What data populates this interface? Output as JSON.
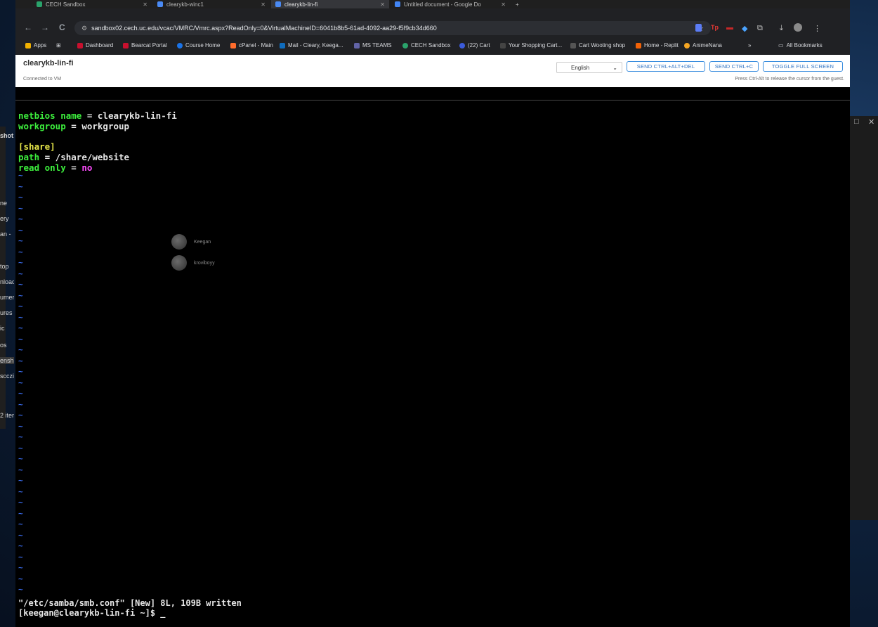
{
  "browser": {
    "tabs": [
      {
        "label": "CECH Sandbox",
        "active": false
      },
      {
        "label": "clearykb-winc1",
        "active": false
      },
      {
        "label": "clearykb-lin-fi",
        "active": true
      },
      {
        "label": "Untitled document - Google Do",
        "active": false
      }
    ],
    "new_tab": "+",
    "url": "sandbox02.cech.uc.edu/vcac/VMRC/Vmrc.aspx?ReadOnly=0&VirtualMachineID=6041b8b5-61ad-4092-aa29-f5f9cb34d660",
    "bookmarks": [
      {
        "label": "Apps",
        "color": "#f2b100"
      },
      {
        "label": "Dashboard",
        "color": "#c8102e"
      },
      {
        "label": "Bearcat Portal",
        "color": "#c8102e"
      },
      {
        "label": "Course Home",
        "color": "#1a73e8"
      },
      {
        "label": "cPanel - Main",
        "color": "#ff6c2c"
      },
      {
        "label": "Mail - Cleary, Keega...",
        "color": "#0f6cbd"
      },
      {
        "label": "MS TEAMS",
        "color": "#6264a7"
      },
      {
        "label": "CECH Sandbox",
        "color": "#2aa36b"
      },
      {
        "label": "(22) Cart",
        "color": "#3b5bdb"
      },
      {
        "label": "Your Shopping Cart...",
        "color": "#444"
      },
      {
        "label": "Cart Wooting shop",
        "color": "#555"
      },
      {
        "label": "Home - Replit",
        "color": "#f26207"
      },
      {
        "label": "AnimeNana",
        "color": "#f5a623"
      }
    ],
    "more_bookmarks": "»",
    "all_bookmarks": "All Bookmarks"
  },
  "vm": {
    "name": "clearykb-lin-fi",
    "status": "Connected to VM",
    "language": "English",
    "send_cad": "SEND CTRL+ALT+DEL",
    "send_ctrl_c": "SEND CTRL+C",
    "toggle_fullscreen": "TOGGLE FULL SCREEN",
    "hint": "Press Ctrl-Alt to release the cursor from the guest."
  },
  "terminal": {
    "line1_key": "netbios name",
    "line1_eq": " = ",
    "line1_val": "clearykb-lin-fi",
    "line2_key": "workgroup",
    "line2_eq": " = ",
    "line2_val": "workgroup",
    "section": "[share]",
    "line4_key": "path",
    "line4_eq": " = ",
    "line4_val": "/share/website",
    "line5_key": "read only",
    "line5_eq": " = ",
    "line5_val": "no",
    "tilde": "~",
    "status_line": "\"/etc/samba/smb.conf\" [New] 8L, 109B written",
    "prompt": "[keegan@clearykb-lin-fi ~]$ _"
  },
  "participants": [
    {
      "name": "Keegan"
    },
    {
      "name": "kroviboyy"
    }
  ],
  "left_peek": [
    "shot:",
    "ne",
    "ery",
    "an -",
    "top",
    "nload",
    "umer",
    "ures",
    "ic",
    "os",
    "ensh",
    "scczi",
    "2 iter"
  ],
  "right_peek": {
    "restore": "□",
    "close": "✕"
  },
  "toolbar_icons": {
    "back": "←",
    "forward": "→",
    "reload": "C",
    "star": "☆",
    "download": "⤓",
    "menu": "⋮"
  }
}
